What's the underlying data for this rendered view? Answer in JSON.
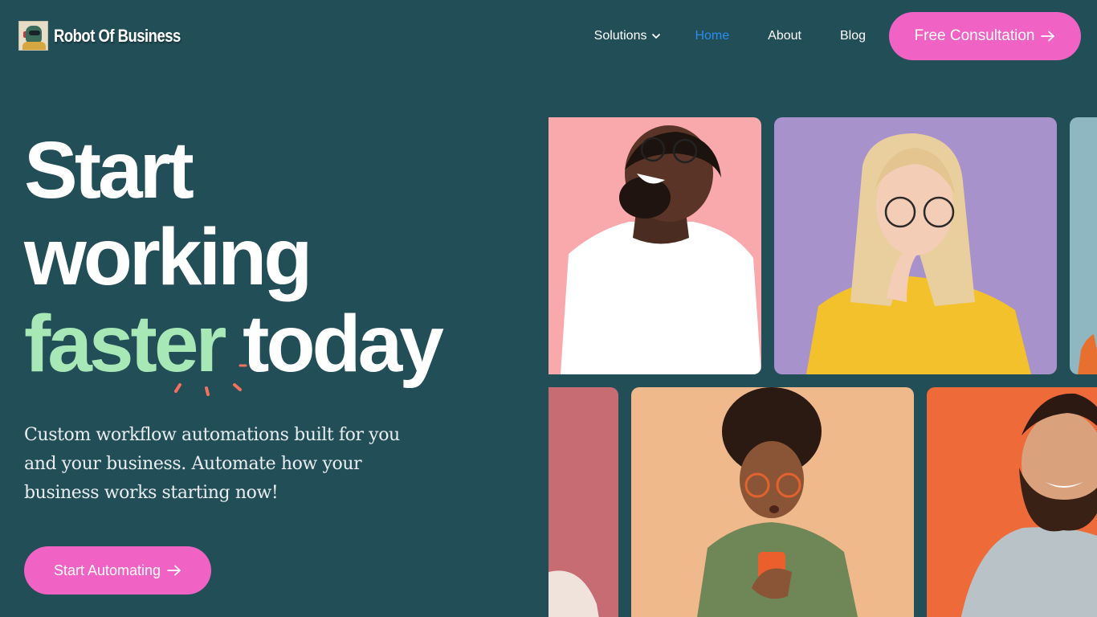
{
  "header": {
    "logo_text": "Robot Of Business",
    "nav": {
      "solutions": "Solutions",
      "home": "Home",
      "about": "About",
      "blog": "Blog"
    },
    "cta_label": "Free Consultation"
  },
  "hero": {
    "line1": "Start",
    "line2": "working",
    "accent_word": "faster",
    "line3_rest": " today",
    "subtext": "Custom workflow automations built for you and your business. Automate how your business works starting now!",
    "button_label": "Start Automating"
  },
  "photos": [
    {
      "name": "photo-man-laughing",
      "bg": "#f9a8ac"
    },
    {
      "name": "photo-woman-thinking",
      "bg": "#a892cc"
    },
    {
      "name": "photo-partial-blue",
      "bg": "#8fb7c2"
    },
    {
      "name": "photo-partial-pink",
      "bg": "#c86c73"
    },
    {
      "name": "photo-woman-phone",
      "bg": "#f0b98b"
    },
    {
      "name": "photo-man-bearded",
      "bg": "#ee6a38"
    }
  ],
  "colors": {
    "background": "#224e57",
    "accent_pink": "#f062c4",
    "accent_green": "#a7e8b6",
    "nav_active": "#2b8ef0",
    "spark": "#f2725e"
  },
  "icons": {
    "logo": "robot-logo-icon",
    "solutions_dropdown": "chevron-down-icon",
    "cta_arrow": "arrow-right-icon"
  }
}
